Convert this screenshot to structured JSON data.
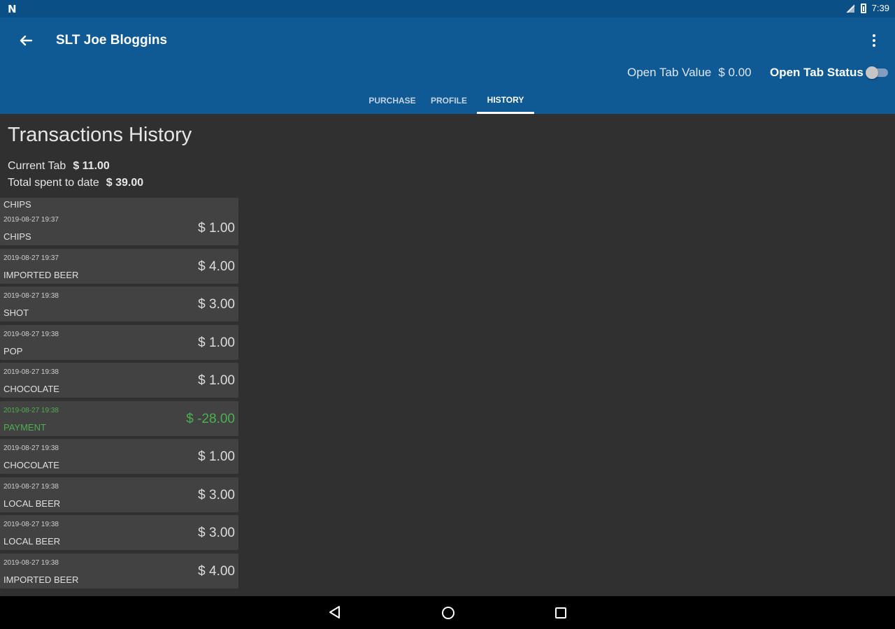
{
  "status_bar": {
    "notification_icon": "N",
    "time": "7:39",
    "icons": [
      "signal-icon",
      "battery-icon"
    ]
  },
  "app_bar": {
    "title": "SLT Joe Bloggins",
    "open_tab_value_label": "Open Tab Value",
    "open_tab_value": "$ 0.00",
    "open_tab_status_label": "Open Tab Status",
    "open_tab_status_on": false
  },
  "tabs": [
    {
      "label": "PURCHASE",
      "active": false
    },
    {
      "label": "PROFILE",
      "active": false
    },
    {
      "label": "HISTORY",
      "active": true
    }
  ],
  "history": {
    "heading": "Transactions History",
    "current_tab_label": "Current Tab",
    "current_tab_value": "$ 11.00",
    "total_spent_label": "Total spent to date",
    "total_spent_value": "$ 39.00",
    "partial_item": {
      "name": "CHIPS"
    },
    "transactions": [
      {
        "timestamp": "2019-08-27 19:37",
        "name": "CHIPS",
        "amount": "$ 1.00",
        "type": "charge"
      },
      {
        "timestamp": "2019-08-27 19:37",
        "name": "IMPORTED BEER",
        "amount": "$ 4.00",
        "type": "charge"
      },
      {
        "timestamp": "2019-08-27 19:38",
        "name": "SHOT",
        "amount": "$ 3.00",
        "type": "charge"
      },
      {
        "timestamp": "2019-08-27 19:38",
        "name": "POP",
        "amount": "$ 1.00",
        "type": "charge"
      },
      {
        "timestamp": "2019-08-27 19:38",
        "name": "CHOCOLATE",
        "amount": "$ 1.00",
        "type": "charge"
      },
      {
        "timestamp": "2019-08-27 19:38",
        "name": "PAYMENT",
        "amount": "$ -28.00",
        "type": "payment"
      },
      {
        "timestamp": "2019-08-27 19:38",
        "name": "CHOCOLATE",
        "amount": "$ 1.00",
        "type": "charge"
      },
      {
        "timestamp": "2019-08-27 19:38",
        "name": "LOCAL BEER",
        "amount": "$ 3.00",
        "type": "charge"
      },
      {
        "timestamp": "2019-08-27 19:38",
        "name": "LOCAL BEER",
        "amount": "$ 3.00",
        "type": "charge"
      },
      {
        "timestamp": "2019-08-27 19:38",
        "name": "IMPORTED BEER",
        "amount": "$ 4.00",
        "type": "charge"
      }
    ]
  },
  "colors": {
    "primary": "#0f5995",
    "status_bar": "#0b4f87",
    "background": "#303030",
    "card": "#424242",
    "payment": "#4caf50"
  },
  "nav_bar": {
    "icons": [
      "nav-back-icon",
      "nav-home-icon",
      "nav-recents-icon"
    ]
  }
}
